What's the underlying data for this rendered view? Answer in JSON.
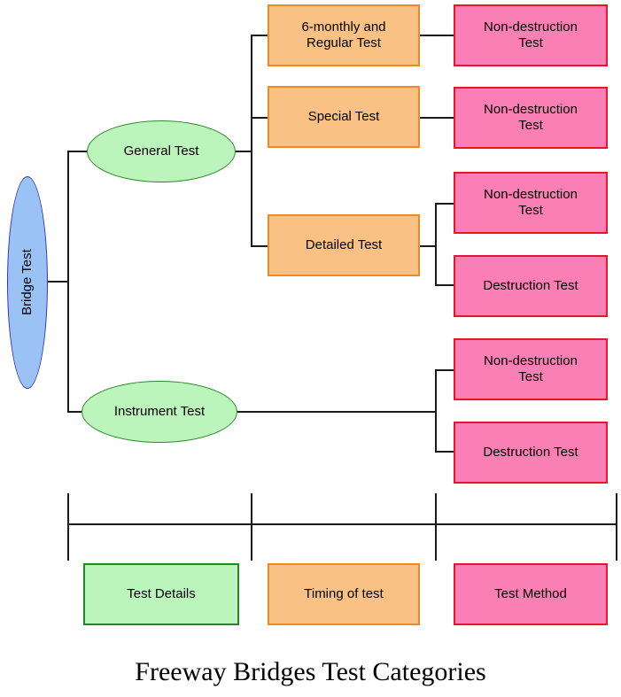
{
  "diagram": {
    "caption": "Freeway Bridges Test Categories",
    "colors": {
      "root_fill": "#9ac2f5",
      "root_stroke": "#3333cc",
      "stage_fill": "#bcf5bc",
      "stage_stroke": "#2e8b2e",
      "timing_fill": "#f9c183",
      "timing_stroke": "#ef8a22",
      "method_fill": "#fa7fb5",
      "method_stroke": "#e8152b",
      "line": "#1a1a1a"
    },
    "root": {
      "label": "Bridge Test"
    },
    "stages": [
      {
        "label": "General Test"
      },
      {
        "label": "Instrument Test"
      }
    ],
    "timings": [
      {
        "label": "6-monthly and\nRegular Test"
      },
      {
        "label": "Special Test"
      },
      {
        "label": "Detailed Test"
      }
    ],
    "methods": [
      {
        "label": "Non-destruction\nTest"
      },
      {
        "label": "Non-destruction\nTest"
      },
      {
        "label": "Non-destruction\nTest"
      },
      {
        "label": "Destruction Test"
      },
      {
        "label": "Non-destruction\nTest"
      },
      {
        "label": "Destruction Test"
      }
    ],
    "legend": {
      "items": [
        {
          "label": "Test Details"
        },
        {
          "label": "Timing of test"
        },
        {
          "label": "Test Method"
        }
      ]
    }
  }
}
